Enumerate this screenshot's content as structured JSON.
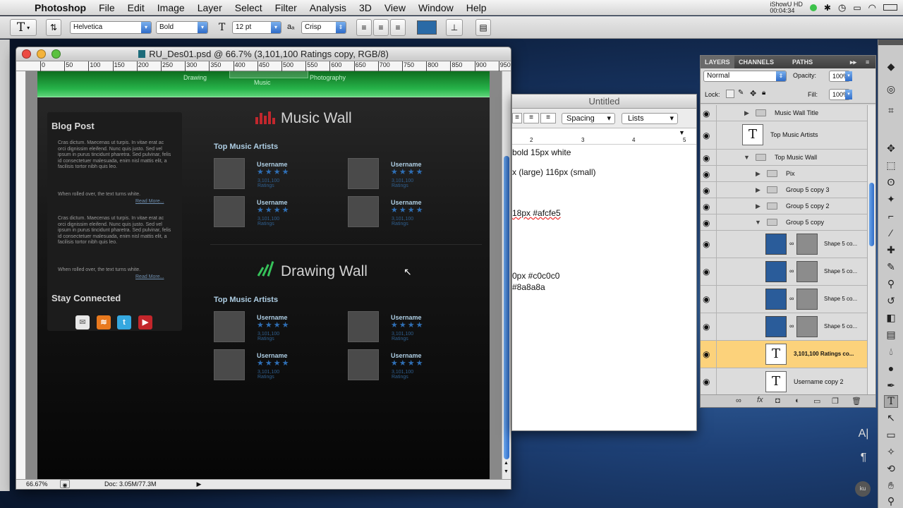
{
  "menubar": {
    "app": "Photoshop",
    "items": [
      "File",
      "Edit",
      "Image",
      "Layer",
      "Select",
      "Filter",
      "Analysis",
      "3D",
      "View",
      "Window",
      "Help"
    ],
    "clock_label": "iShowU HD",
    "clock_time": "00:04:34"
  },
  "options": {
    "font_family": "Helvetica",
    "font_style": "Bold",
    "font_size": "12 pt",
    "antialias": "Crisp",
    "text_color": "#2a6aa6"
  },
  "document": {
    "title": "RU_Des01.psd @ 66.7% (3,101,100 Ratings copy, RGB/8)",
    "zoom": "66.67%",
    "doc_size": "Doc: 3.05M/77.3M",
    "ruler_ticks": [
      "0",
      "50",
      "100",
      "150",
      "200",
      "250",
      "300",
      "350",
      "400",
      "450",
      "500",
      "550",
      "600",
      "650",
      "700",
      "750",
      "800",
      "850",
      "900",
      "950"
    ]
  },
  "design": {
    "nav": [
      "Drawing",
      "Music",
      "Photography"
    ],
    "sidebar": {
      "blog_heading": "Blog Post",
      "para1": "Cras dictum. Maecenas ut turpis. In vitae erat ac orci dignissim eleifend. Nunc quis justo. Sed vel ipsum in purus tincidunt pharetra. Sed pulvinar, felis id consectetuer malesuada, enim nisl mattis elit, a facilisis tortor nibh quis leo.",
      "rollover1": "When rolled over, the text turns white.",
      "readmore1": "Read More...",
      "para2": "Cras dictum. Maecenas ut turpis. In vitae erat ac orci dignissim eleifend. Nunc quis justo. Sed vel ipsum in purus tincidunt pharetra. Sed pulvinar, felis id consectetuer malesuada, enim nisl mattis elit, a facilisis tortor nibh quis leo.",
      "rollover2": "When rolled over, the text turns white.",
      "readmore2": "Read More...",
      "connected_heading": "Stay Connected",
      "social": [
        "mail-icon",
        "rss-icon",
        "twitter-icon",
        "youtube-icon"
      ]
    },
    "music_wall": {
      "title": "Music Wall",
      "subhead": "Top Music Artists",
      "cards": [
        {
          "user": "Username",
          "ratings": "3,101,100 Ratings"
        },
        {
          "user": "Username",
          "ratings": "3,101,100 Ratings"
        },
        {
          "user": "Username",
          "ratings": "3,101,100 Ratings"
        },
        {
          "user": "Username",
          "ratings": "3,101,100 Ratings"
        }
      ]
    },
    "drawing_wall": {
      "title": "Drawing Wall",
      "subhead": "Top Music Artists",
      "cards": [
        {
          "user": "Username",
          "ratings": "3,101,100 Ratings"
        },
        {
          "user": "Username",
          "ratings": "3,101,100 Ratings"
        },
        {
          "user": "Username",
          "ratings": "3,101,100 Ratings"
        },
        {
          "user": "Username",
          "ratings": "3,101,100 Ratings"
        }
      ]
    }
  },
  "textedit": {
    "title": "Untitled",
    "spacing": "Spacing",
    "lists": "Lists",
    "ruler_nums": [
      "2",
      "3",
      "4",
      "5"
    ],
    "lines": [
      "bold 15px white",
      "x (large)  116px (small)",
      "18px #afcfe5",
      "0px #c0c0c0",
      "#8a8a8a"
    ]
  },
  "layers": {
    "tabs": [
      "LAYERS",
      "CHANNELS",
      "PATHS"
    ],
    "blend": "Normal",
    "opacity_label": "Opacity:",
    "opacity": "100%",
    "lock_label": "Lock:",
    "fill_label": "Fill:",
    "fill": "100%",
    "rows": [
      {
        "name": "Music Wall Title"
      },
      {
        "name": "Top Music Artists"
      },
      {
        "name": "Top Music Wall"
      },
      {
        "name": "Pix"
      },
      {
        "name": "Group 5 copy 3"
      },
      {
        "name": "Group 5 copy 2"
      },
      {
        "name": "Group 5 copy"
      },
      {
        "name": "Shape 5 co..."
      },
      {
        "name": "Shape 5 co..."
      },
      {
        "name": "Shape 5 co..."
      },
      {
        "name": "Shape 5 co..."
      },
      {
        "name": "3,101,100 Ratings co..."
      },
      {
        "name": "Username copy 2"
      }
    ]
  }
}
